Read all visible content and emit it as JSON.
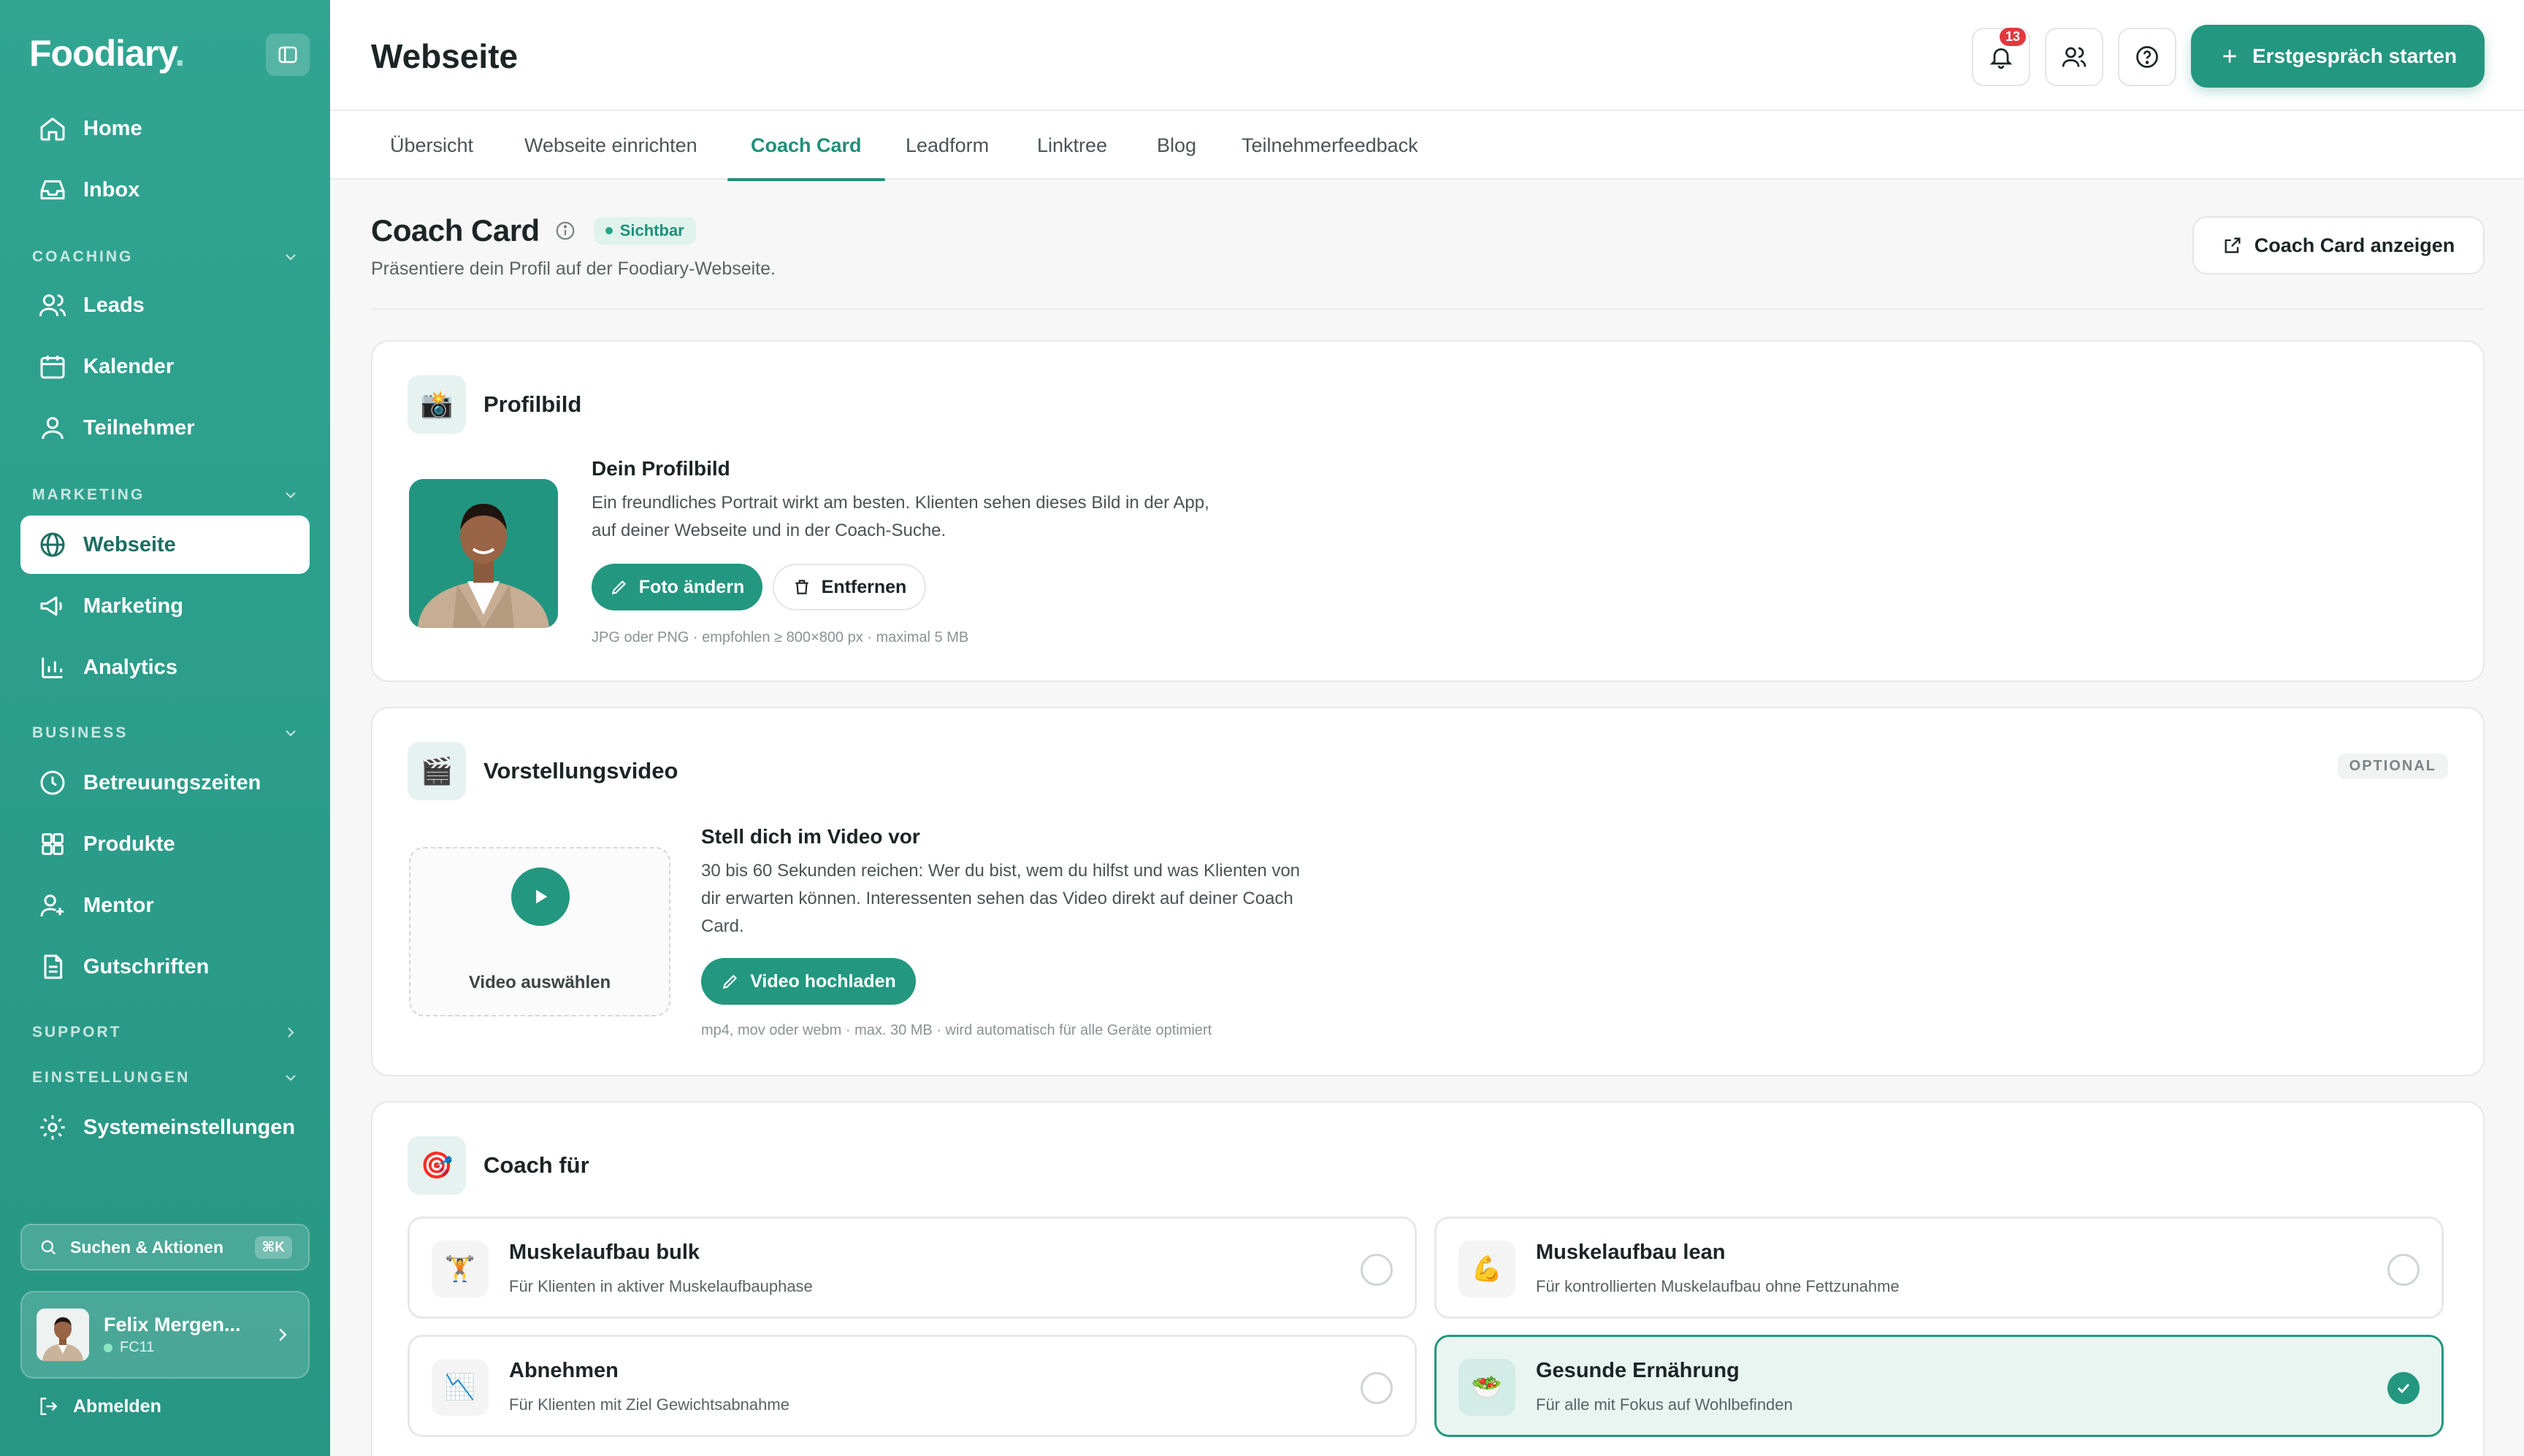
{
  "sidebar": {
    "logo": "Foodiary",
    "logo_dot": ".",
    "nav_top": [
      {
        "label": "Home"
      },
      {
        "label": "Inbox"
      }
    ],
    "sections": {
      "coaching": "COACHING",
      "marketing": "MARKETING",
      "business": "BUSINESS",
      "support": "SUPPORT",
      "settings": "EINSTELLUNGEN"
    },
    "coaching_items": [
      {
        "label": "Leads"
      },
      {
        "label": "Kalender"
      },
      {
        "label": "Teilnehmer"
      }
    ],
    "marketing_items": [
      {
        "label": "Webseite"
      },
      {
        "label": "Marketing"
      },
      {
        "label": "Analytics"
      }
    ],
    "business_items": [
      {
        "label": "Betreuungszeiten"
      },
      {
        "label": "Produkte"
      },
      {
        "label": "Mentor"
      },
      {
        "label": "Gutschriften"
      }
    ],
    "settings_items": [
      {
        "label": "Systemeinstellungen"
      }
    ],
    "search_label": "Suchen & Aktionen",
    "search_shortcut": "⌘K",
    "user": {
      "name": "Felix Mergen...",
      "code": "FC11"
    },
    "logout": "Abmelden"
  },
  "header": {
    "title": "Webseite",
    "notification_count": "13",
    "cta_label": "Erstgespräch starten"
  },
  "tabs": [
    {
      "label": "Übersicht"
    },
    {
      "label": "Webseite einrichten"
    },
    {
      "label": "Coach Card"
    },
    {
      "label": "Leadform"
    },
    {
      "label": "Linktree"
    },
    {
      "label": "Blog"
    },
    {
      "label": "Teilnehmerfeedback"
    }
  ],
  "active_tab": "Coach Card",
  "page": {
    "title": "Coach Card",
    "visibility_badge": "Sichtbar",
    "subtitle": "Präsentiere dein Profil auf der Foodiary-Webseite.",
    "view_button": "Coach Card anzeigen"
  },
  "profile_card": {
    "emoji": "📸",
    "title": "Profilbild",
    "field_title": "Dein Profilbild",
    "desc_line1": "Ein freundliches Portrait wirkt am besten. Klienten sehen dieses Bild in der App,",
    "desc_line2": "auf deiner Webseite und in der Coach-Suche.",
    "change_button": "Foto ändern",
    "remove_button": "Entfernen",
    "hint": "JPG oder PNG · empfohlen ≥ 800×800 px · maximal 5 MB"
  },
  "video_card": {
    "emoji": "🎬",
    "title": "Vorstellungsvideo",
    "optional_tag": "OPTIONAL",
    "select_label": "Video auswählen",
    "field_title": "Stell dich im Video vor",
    "desc_line1": "30 bis 60 Sekunden reichen: Wer du bist, wem du hilfst und was Klienten von",
    "desc_line2": "dir erwarten können. Interessenten sehen das Video direkt auf deiner Coach",
    "desc_line3": "Card.",
    "upload_button": "Video hochladen",
    "hint": "mp4, mov oder webm · max. 30 MB · wird automatisch für alle Geräte optimiert"
  },
  "coach_for_card": {
    "emoji": "🎯",
    "title": "Coach für",
    "options": [
      {
        "emoji": "🏋️",
        "title": "Muskelaufbau bulk",
        "desc": "Für Klienten in aktiver Muskelaufbauphase",
        "selected": false
      },
      {
        "emoji": "💪",
        "title": "Muskelaufbau lean",
        "desc": "Für kontrollierten Muskelaufbau ohne Fettzunahme",
        "selected": false
      },
      {
        "emoji": "📉",
        "title": "Abnehmen",
        "desc": "Für Klienten mit Ziel Gewichtsabnahme",
        "selected": false
      },
      {
        "emoji": "🥗",
        "title": "Gesunde Ernährung",
        "desc": "Für alle mit Fokus auf Wohlbefinden",
        "selected": true
      }
    ]
  },
  "colors": {
    "brand": "#23977f",
    "sidebar_bg": "#2a9c89",
    "badge_red": "#e0383e"
  }
}
